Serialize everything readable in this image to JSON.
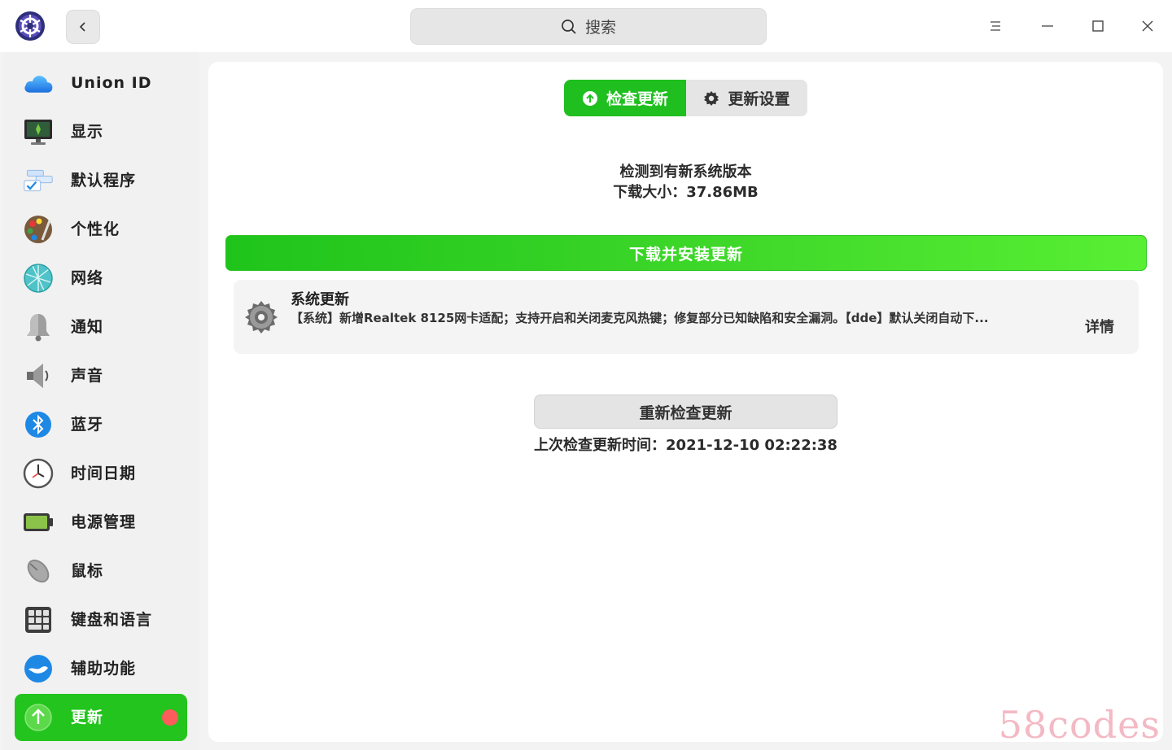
{
  "titlebar": {
    "search_label": "搜索",
    "icons": [
      "app-logo",
      "back-arrow-icon",
      "search-icon",
      "menu-icon",
      "minimize-icon",
      "maximize-icon",
      "close-icon"
    ]
  },
  "sidebar": {
    "items": [
      {
        "label": "Union ID",
        "icon": "cloud-icon"
      },
      {
        "label": "显示",
        "icon": "monitor-icon"
      },
      {
        "label": "默认程序",
        "icon": "default-apps-icon"
      },
      {
        "label": "个性化",
        "icon": "palette-icon"
      },
      {
        "label": "网络",
        "icon": "network-globe-icon"
      },
      {
        "label": "通知",
        "icon": "bell-icon"
      },
      {
        "label": "声音",
        "icon": "speaker-icon"
      },
      {
        "label": "蓝牙",
        "icon": "bluetooth-icon"
      },
      {
        "label": "时间日期",
        "icon": "clock-icon"
      },
      {
        "label": "电源管理",
        "icon": "battery-icon"
      },
      {
        "label": "鼠标",
        "icon": "mouse-icon"
      },
      {
        "label": "键盘和语言",
        "icon": "keyboard-icon"
      },
      {
        "label": "辅助功能",
        "icon": "accessibility-icon"
      },
      {
        "label": "更新",
        "icon": "update-arrow-icon",
        "active": true,
        "has_badge": true
      }
    ],
    "active_color": "#22c41d",
    "badge_color": "#ff5c5c"
  },
  "main": {
    "tabs": {
      "check_label": "检查更新",
      "settings_label": "更新设置"
    },
    "status": {
      "line1": "检测到有新系统版本",
      "line2": "下载大小：37.86MB"
    },
    "download_button": "下载并安装更新",
    "update_item": {
      "name": "系统更新",
      "description": "【系统】新增Realtek 8125网卡适配；支持开启和关闭麦克风热键；修复部分已知缺陷和安全漏洞。【dde】默认关闭自动下...",
      "detail_label": "详情"
    },
    "recheck_button": "重新检查更新",
    "last_check": "上次检查更新时间：2021-12-10 02:22:38"
  },
  "watermark": "58codes",
  "colors": {
    "accent_green": "#1fbf1f",
    "gradient_start": "#1fc41b",
    "gradient_end": "#58ef33"
  }
}
